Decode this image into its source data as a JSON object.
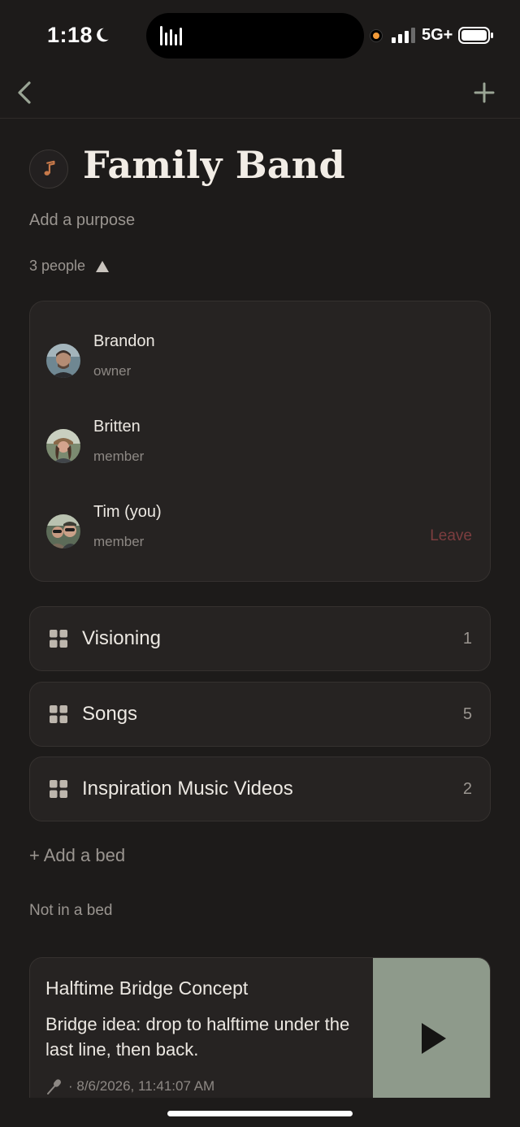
{
  "status_bar": {
    "time": "1:18",
    "network": "5G+",
    "icons": [
      "moon-icon",
      "audio-bars-icon",
      "orange-dot-indicator",
      "signal-icon",
      "battery-icon"
    ]
  },
  "nav": {
    "back_icon": "chevron-left-icon",
    "add_icon": "plus-icon"
  },
  "header": {
    "icon": "music-note-icon",
    "title": "Family Band",
    "purpose_placeholder": "Add a purpose",
    "people_toggle": "3 people"
  },
  "members": [
    {
      "name": "Brandon",
      "role": "owner"
    },
    {
      "name": "Britten",
      "role": "member"
    },
    {
      "name": "Tim (you)",
      "role": "member",
      "action": "Leave"
    }
  ],
  "beds": [
    {
      "label": "Visioning",
      "count": "1"
    },
    {
      "label": "Songs",
      "count": "5"
    },
    {
      "label": "Inspiration Music Videos",
      "count": "2"
    }
  ],
  "add_bed_label": "+ Add a bed",
  "unsorted_section": "Not in a bed",
  "items": [
    {
      "title": "Halftime Bridge Concept",
      "body": "Bridge idea: drop to halftime under the last line, then back.",
      "meta": "· 8/6/2026, 11:41:07 AM",
      "type_icon": "microphone-icon"
    }
  ],
  "colors": {
    "background": "#1d1b1a",
    "card": "#262322",
    "leave": "#7c3d3f",
    "note_accent": "#c7794a",
    "play_panel": "#8e9a8b"
  }
}
